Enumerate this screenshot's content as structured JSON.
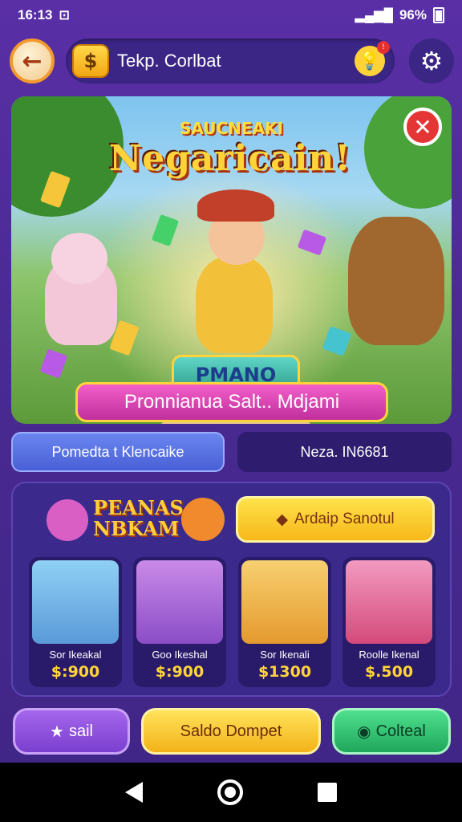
{
  "status_bar": {
    "time": "16:13",
    "battery": "96%"
  },
  "header": {
    "title": "Tekp. Corlbat",
    "settings_icon": "gear-icon",
    "back_icon": "arrow-left-icon"
  },
  "hero": {
    "supertitle": "SAUCNEAKI",
    "title": "Negaricain!",
    "badge": "PMANO",
    "banner": "Pronnianua Salt.. Mdjami"
  },
  "tabs": {
    "active": "Pomedta t Klencaike",
    "inactive": "Neza. IN6681"
  },
  "panel": {
    "logo_line1": "PEANAS",
    "logo_line2": "NBKAM",
    "cta_label": "Ardaip Sanotul",
    "cards": [
      {
        "label": "Sor Ikeakal",
        "price": "$:900",
        "color": "#6fb0e8"
      },
      {
        "label": "Goo Ikeshal",
        "price": "$:900",
        "color": "#b068d8"
      },
      {
        "label": "Sor Ikenali",
        "price": "$1300",
        "color": "#f2a23c"
      },
      {
        "label": "Roolle Ikenal",
        "price": "$.500",
        "color": "#e85a8a"
      }
    ]
  },
  "bottom": {
    "mail": "sail",
    "saldo": "Saldo Dompet",
    "collect": "Colteal"
  }
}
